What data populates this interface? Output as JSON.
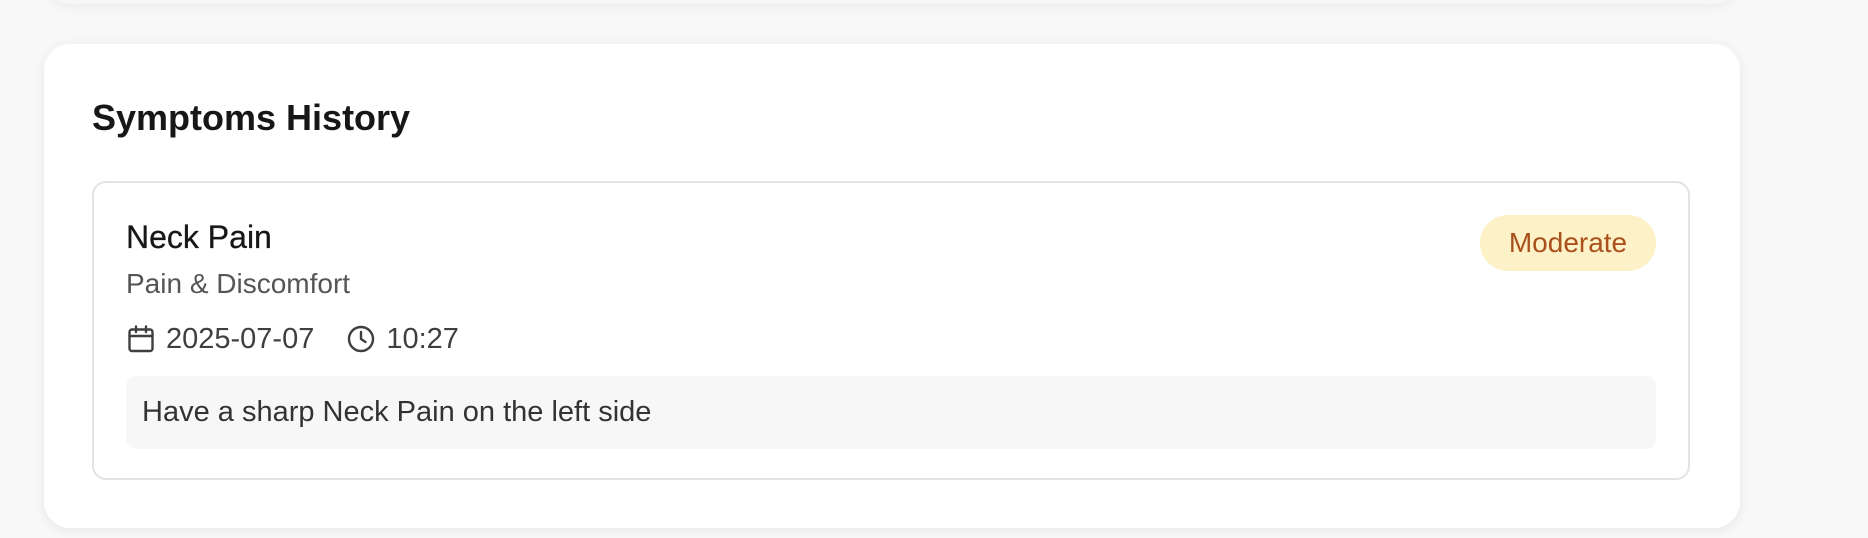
{
  "section": {
    "title": "Symptoms History"
  },
  "symptoms": [
    {
      "name": "Neck Pain",
      "category": "Pain & Discomfort",
      "date": "2025-07-07",
      "time": "10:27",
      "severity": "Moderate",
      "note": "Have a sharp Neck Pain on the left side",
      "icons": {
        "date": "calendar-icon",
        "time": "clock-icon"
      }
    }
  ],
  "colors": {
    "page_background": "#f8f8f8",
    "card_background": "#ffffff",
    "severity_moderate_bg": "#fdf1c7",
    "severity_moderate_text": "#a9501c",
    "note_background": "#f7f7f7"
  }
}
